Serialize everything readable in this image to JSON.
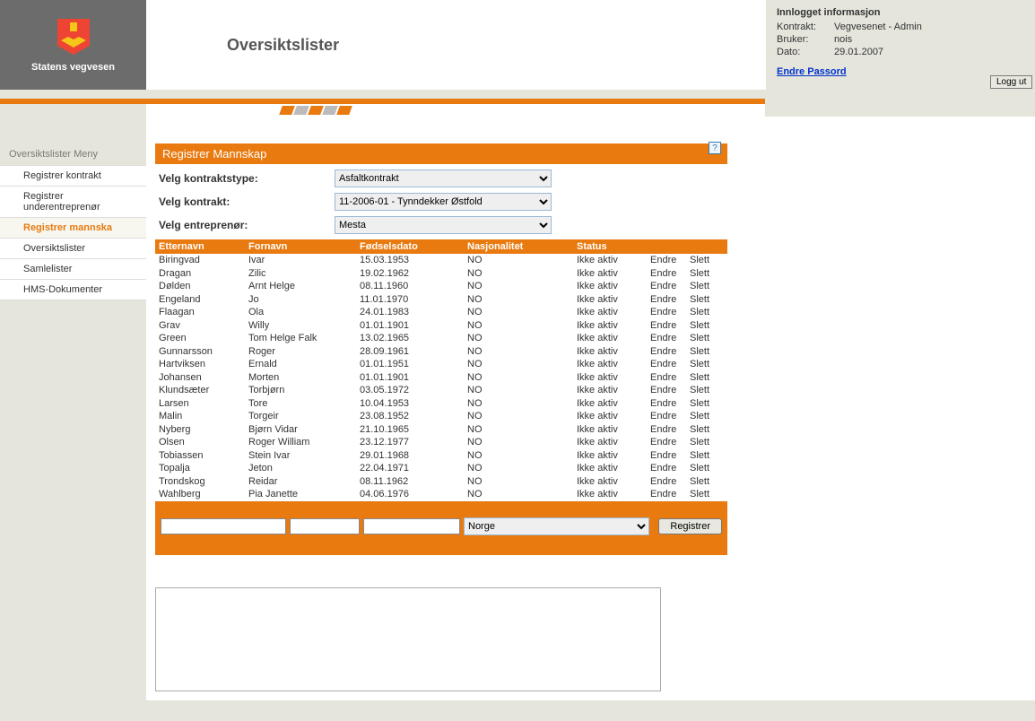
{
  "app": {
    "org": "Statens vegvesen",
    "page_title": "Oversiktslister"
  },
  "session": {
    "header": "Innlogget informasjon",
    "kontrakt_lbl": "Kontrakt:",
    "kontrakt": "Vegvesenet - Admin",
    "bruker_lbl": "Bruker:",
    "bruker": "nois",
    "dato_lbl": "Dato:",
    "dato": "29.01.2007",
    "change_pw": "Endre Passord",
    "logout": "Logg ut"
  },
  "menu": {
    "header": "Oversiktslister Meny",
    "items": [
      "Registrer kontrakt",
      "Registrer underentreprenør",
      "Registrer mannskap",
      "Oversiktslister",
      "Samlelister",
      "HMS-Dokumenter"
    ],
    "active_index": 2
  },
  "panel": {
    "title": "Registrer Mannskap",
    "field1_lbl": "Velg kontraktstype:",
    "field1_val": "Asfaltkontrakt",
    "field2_lbl": "Velg kontrakt:",
    "field2_val": "11-2006-01 - Tynndekker Østfold",
    "field3_lbl": "Velg entreprenør:",
    "field3_val": "Mesta"
  },
  "table": {
    "headers": [
      "Etternavn",
      "Fornavn",
      "Fødselsdato",
      "Nasjonalitet",
      "Status"
    ],
    "edit": "Endre",
    "del": "Slett",
    "rows": [
      {
        "e": "Biringvad",
        "f": "Ivar",
        "d": "15.03.1953",
        "n": "NO",
        "s": "Ikke aktiv"
      },
      {
        "e": "Dragan",
        "f": "Zilic",
        "d": "19.02.1962",
        "n": "NO",
        "s": "Ikke aktiv"
      },
      {
        "e": "Dølden",
        "f": "Arnt Helge",
        "d": "08.11.1960",
        "n": "NO",
        "s": "Ikke aktiv"
      },
      {
        "e": "Engeland",
        "f": "Jo",
        "d": "11.01.1970",
        "n": "NO",
        "s": "Ikke aktiv"
      },
      {
        "e": "Flaagan",
        "f": "Ola",
        "d": "24.01.1983",
        "n": "NO",
        "s": "Ikke aktiv"
      },
      {
        "e": "Grav",
        "f": "Willy",
        "d": "01.01.1901",
        "n": "NO",
        "s": "Ikke aktiv"
      },
      {
        "e": "Green",
        "f": "Tom Helge Falk",
        "d": "13.02.1965",
        "n": "NO",
        "s": "Ikke aktiv"
      },
      {
        "e": "Gunnarsson",
        "f": "Roger",
        "d": "28.09.1961",
        "n": "NO",
        "s": "Ikke aktiv"
      },
      {
        "e": "Hartviksen",
        "f": "Ernald",
        "d": "01.01.1951",
        "n": "NO",
        "s": "Ikke aktiv"
      },
      {
        "e": "Johansen",
        "f": "Morten",
        "d": "01.01.1901",
        "n": "NO",
        "s": "Ikke aktiv"
      },
      {
        "e": "Klundsæter",
        "f": "Torbjørn",
        "d": "03.05.1972",
        "n": "NO",
        "s": "Ikke aktiv"
      },
      {
        "e": "Larsen",
        "f": "Tore",
        "d": "10.04.1953",
        "n": "NO",
        "s": "Ikke aktiv"
      },
      {
        "e": "Malin",
        "f": "Torgeir",
        "d": "23.08.1952",
        "n": "NO",
        "s": "Ikke aktiv"
      },
      {
        "e": "Nyberg",
        "f": "Bjørn Vidar",
        "d": "21.10.1965",
        "n": "NO",
        "s": "Ikke aktiv"
      },
      {
        "e": "Olsen",
        "f": "Roger William",
        "d": "23.12.1977",
        "n": "NO",
        "s": "Ikke aktiv"
      },
      {
        "e": "Tobiassen",
        "f": "Stein Ivar",
        "d": "29.01.1968",
        "n": "NO",
        "s": "Ikke aktiv"
      },
      {
        "e": "Topalja",
        "f": "Jeton",
        "d": "22.04.1971",
        "n": "NO",
        "s": "Ikke aktiv"
      },
      {
        "e": "Trondskog",
        "f": "Reidar",
        "d": "08.11.1962",
        "n": "NO",
        "s": "Ikke aktiv"
      },
      {
        "e": "Wahlberg",
        "f": "Pia Janette",
        "d": "04.06.1976",
        "n": "NO",
        "s": "Ikke aktiv"
      }
    ]
  },
  "register": {
    "country": "Norge",
    "button": "Registrer"
  }
}
